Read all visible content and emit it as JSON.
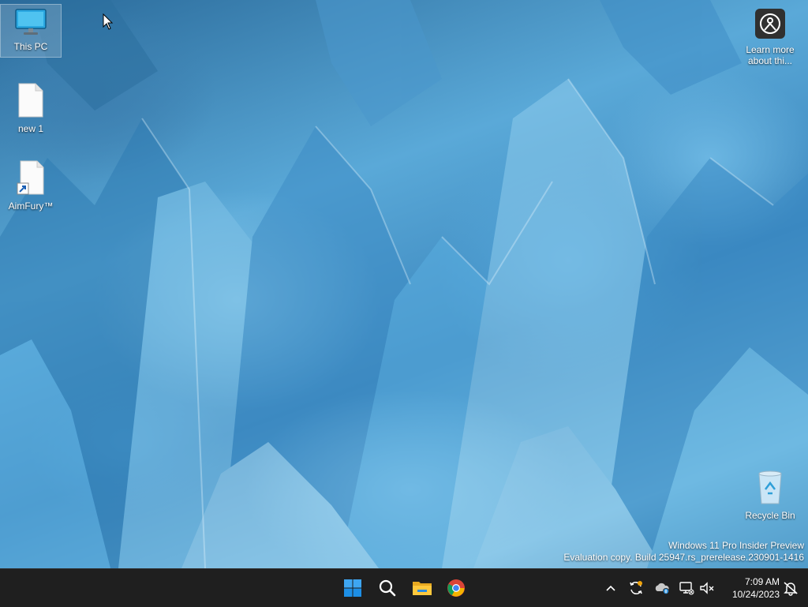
{
  "desktop": {
    "icons": [
      {
        "label": "This PC"
      },
      {
        "label": "new 1"
      },
      {
        "label": "AimFury™"
      },
      {
        "label": "Learn more about thi..."
      },
      {
        "label": "Recycle Bin"
      }
    ],
    "watermark": {
      "line1": "Windows 11 Pro Insider Preview",
      "line2": "Evaluation copy. Build 25947.rs_prerelease.230901-1416"
    }
  },
  "taskbar": {
    "apps": [
      {
        "name": "start-button",
        "icon": "windows-logo-icon"
      },
      {
        "name": "search-button",
        "icon": "search-icon"
      },
      {
        "name": "file-explorer",
        "icon": "folder-icon"
      },
      {
        "name": "chrome",
        "icon": "chrome-icon"
      }
    ],
    "tray": [
      {
        "icon": "chevron-up-icon"
      },
      {
        "icon": "update-icon"
      },
      {
        "icon": "onedrive-icon"
      },
      {
        "icon": "network-icon"
      },
      {
        "icon": "volume-muted-icon"
      }
    ],
    "clock": {
      "time": "7:09 AM",
      "date": "10/24/2023"
    }
  },
  "colors": {
    "taskbar": "#1f1f1f",
    "accent_blue": "#0f6cbd",
    "wallpaper_ice": "#5aa9d8"
  }
}
